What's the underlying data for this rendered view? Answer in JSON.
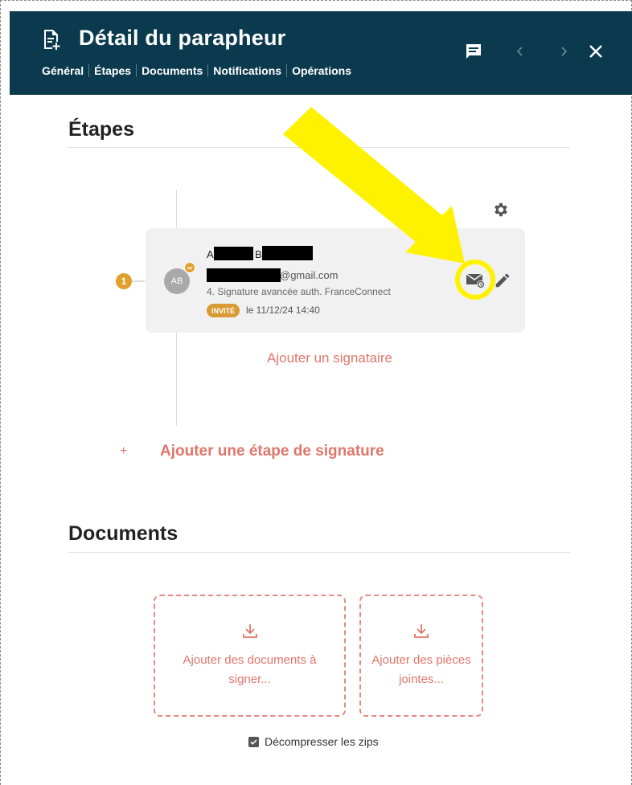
{
  "header": {
    "title": "Détail du parapheur",
    "tabs": [
      {
        "label": "Général"
      },
      {
        "label": "Étapes"
      },
      {
        "label": "Documents"
      },
      {
        "label": "Notifications"
      },
      {
        "label": "Opérations"
      }
    ],
    "icons": [
      "document-add-icon",
      "comment-icon",
      "chevron-left-icon",
      "chevron-right-icon",
      "close-icon"
    ]
  },
  "steps_section": {
    "title": "Étapes",
    "step": {
      "number": "1",
      "signer": {
        "avatar_initials": "AB",
        "first_initial": "A",
        "last_initial": "B",
        "email_suffix": "@gmail.com",
        "signature_type": "4. Signature avancée auth. FranceConnect",
        "status_badge": "INVITÉ",
        "status_date": "le 11/12/24 14:40"
      }
    },
    "add_signer_label": "Ajouter un signataire",
    "add_step_plus": "+",
    "add_step_label": "Ajouter une étape de signature"
  },
  "documents_section": {
    "title": "Documents",
    "add_documents_label": "Ajouter des documents à signer...",
    "add_attachments_label": "Ajouter des pièces jointes...",
    "unzip_label": "Décompresser les zips",
    "unzip_checked": true
  },
  "colors": {
    "header_bg": "#0b3a4f",
    "accent_link": "#e0766b",
    "badge_orange": "#d99a34",
    "annotation_yellow": "#fff200"
  }
}
